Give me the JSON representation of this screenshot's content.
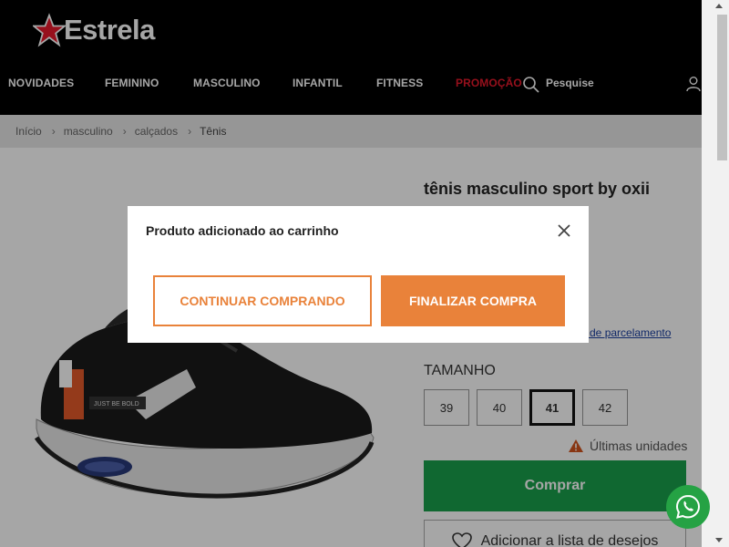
{
  "brand": {
    "logo_text": "Estrela"
  },
  "nav": {
    "items": [
      "NOVIDADES",
      "FEMININO",
      "MASCULINO",
      "INFANTIL",
      "FITNESS",
      "PROMOÇÃO"
    ],
    "search_label": "Pesquise"
  },
  "breadcrumb": [
    "Início",
    "masculino",
    "calçados",
    "Tênis"
  ],
  "product": {
    "title": "tênis masculino sport by oxii",
    "installments_link": "es de parcelamento",
    "size_label": "TAMANHO",
    "sizes": [
      "39",
      "40",
      "41",
      "42"
    ],
    "selected_size": "41",
    "stock_warning": "Últimas unidades",
    "buy_label": "Comprar",
    "wishlist_label": "Adicionar a lista de desejos"
  },
  "modal": {
    "title": "Produto adicionado ao carrinho",
    "continue_label": "CONTINUAR COMPRANDO",
    "finish_label": "FINALIZAR COMPRA"
  },
  "colors": {
    "accent_orange": "#e9823a",
    "buy_green": "#1aa04c",
    "promo_red": "#e8192c",
    "header_bg": "#000000"
  },
  "icons": [
    "star-logo-icon",
    "search-icon",
    "user-icon",
    "close-icon",
    "warning-icon",
    "heart-icon",
    "whatsapp-icon"
  ]
}
